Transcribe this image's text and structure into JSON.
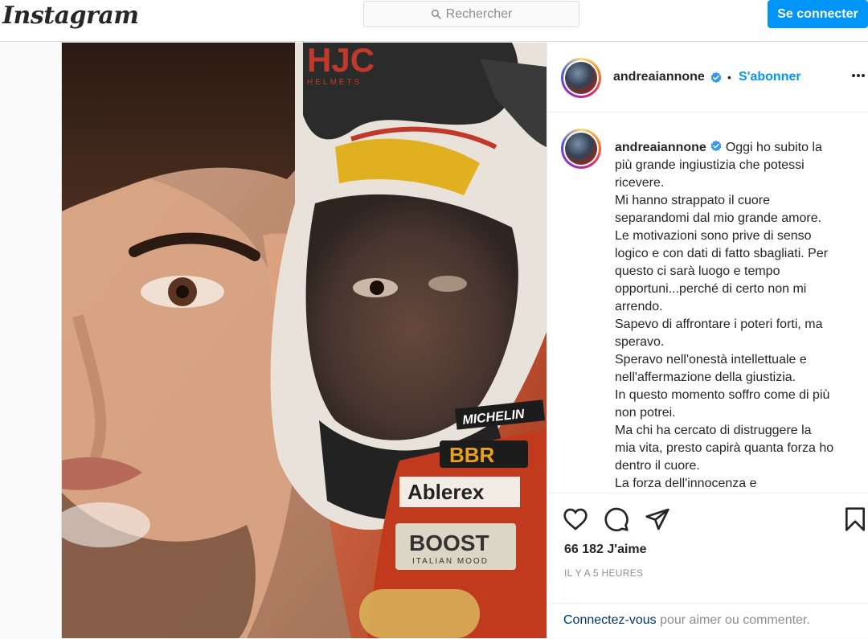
{
  "header": {
    "logo": "Instagram",
    "search_placeholder": "Rechercher",
    "login_label": "Se connecter"
  },
  "post": {
    "username": "andreaiannone",
    "follow_label": "S'abonner",
    "dot": "•",
    "caption_lines": [
      "Oggi ho subito la",
      "più grande ingiustizia che potessi",
      "ricevere.",
      "Mi hanno strappato il cuore",
      "separandomi dal mio grande amore.",
      "Le motivazioni sono prive di senso",
      "logico e con dati di fatto sbagliati. Per",
      "questo ci sarà luogo e tempo",
      "opportuni...perché di certo non mi",
      "arrendo.",
      "Sapevo di affrontare i poteri forti, ma",
      "speravo.",
      "Speravo nell'onestà intellettuale e",
      "nell'affermazione della giustizia.",
      "In questo momento soffro come di più",
      "non potrei.",
      "Ma chi ha cercato di distruggere la",
      "mia vita, presto capirà quanta forza ho",
      "dentro il cuore.",
      "La forza dell'innocenza e"
    ],
    "likes": "66 182 J'aime",
    "time_ago": "IL Y A 5 HEURES",
    "login_link": "Connectez-vous",
    "login_prompt": " pour aimer ou commenter."
  },
  "photo_text": {
    "helmet_brand": "HJC",
    "helmet_sub": "HELMETS",
    "sponsor_michelin": "MICHELIN",
    "sponsor_ablerex": "Ablerex",
    "sponsor_boost": "BOOST",
    "sponsor_boost_sub": "ITALIAN MOOD",
    "sponsor_bb": "BBR"
  },
  "icons": [
    "search-icon",
    "verified-icon",
    "more-icon",
    "heart-icon",
    "comment-icon",
    "share-icon",
    "bookmark-icon"
  ],
  "colors": {
    "accent": "#0095f6",
    "verified": "#3897f0",
    "link": "#00376b",
    "muted": "#8e8e8e"
  }
}
